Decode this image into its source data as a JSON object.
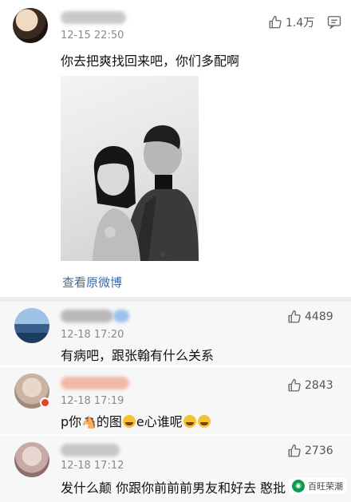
{
  "post": {
    "time": "12-15 22:50",
    "likes": "1.4万",
    "text": "你去把爽找回来吧，你们多配啊",
    "view_original": "查看原微博"
  },
  "comments": [
    {
      "time": "12-18 17:20",
      "likes": "4489",
      "text": "有病吧，跟张翰有什么关系"
    },
    {
      "time": "12-18 17:19",
      "likes": "2843",
      "text_a": "p你",
      "text_b": "的图",
      "text_c": "e心谁呢"
    },
    {
      "time": "12-18 17:12",
      "likes": "2736",
      "text": "发什么颠 你跟你前前前男友和好去 憨批"
    }
  ],
  "watermark": "百旺荣潮",
  "colors": {
    "link": "#3d6aa7",
    "comment_bg": "#f7f7f7",
    "divider": "#ececec"
  }
}
